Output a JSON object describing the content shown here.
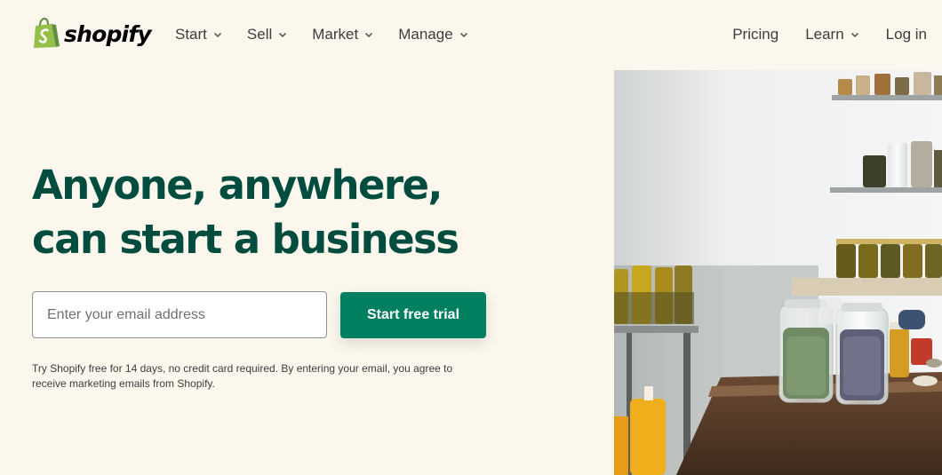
{
  "brand": {
    "name": "shopify",
    "logo_icon": "shopping-bag-icon",
    "logo_color": "#95bf47"
  },
  "nav": {
    "left_items": [
      {
        "label": "Start",
        "icon": "chevron-down-icon"
      },
      {
        "label": "Sell",
        "icon": "chevron-down-icon"
      },
      {
        "label": "Market",
        "icon": "chevron-down-icon"
      },
      {
        "label": "Manage",
        "icon": "chevron-down-icon"
      }
    ],
    "right_items": [
      {
        "label": "Pricing"
      },
      {
        "label": "Learn",
        "icon": "chevron-down-icon"
      },
      {
        "label": "Log in"
      }
    ]
  },
  "hero": {
    "title_line1": "Anyone, anywhere,",
    "title_line2": "can start a business",
    "email_placeholder": "Enter your email address",
    "email_value": "",
    "cta_label": "Start free trial",
    "disclaimer": "Try Shopify free for 14 days, no credit card required. By entering your email, you agree to receive marketing emails from Shopify."
  },
  "colors": {
    "background": "#fbf7ed",
    "heading": "#004c3f",
    "cta": "#008060"
  },
  "hero_image": {
    "subject": "jars-of-herbs-on-shelves-and-table"
  }
}
